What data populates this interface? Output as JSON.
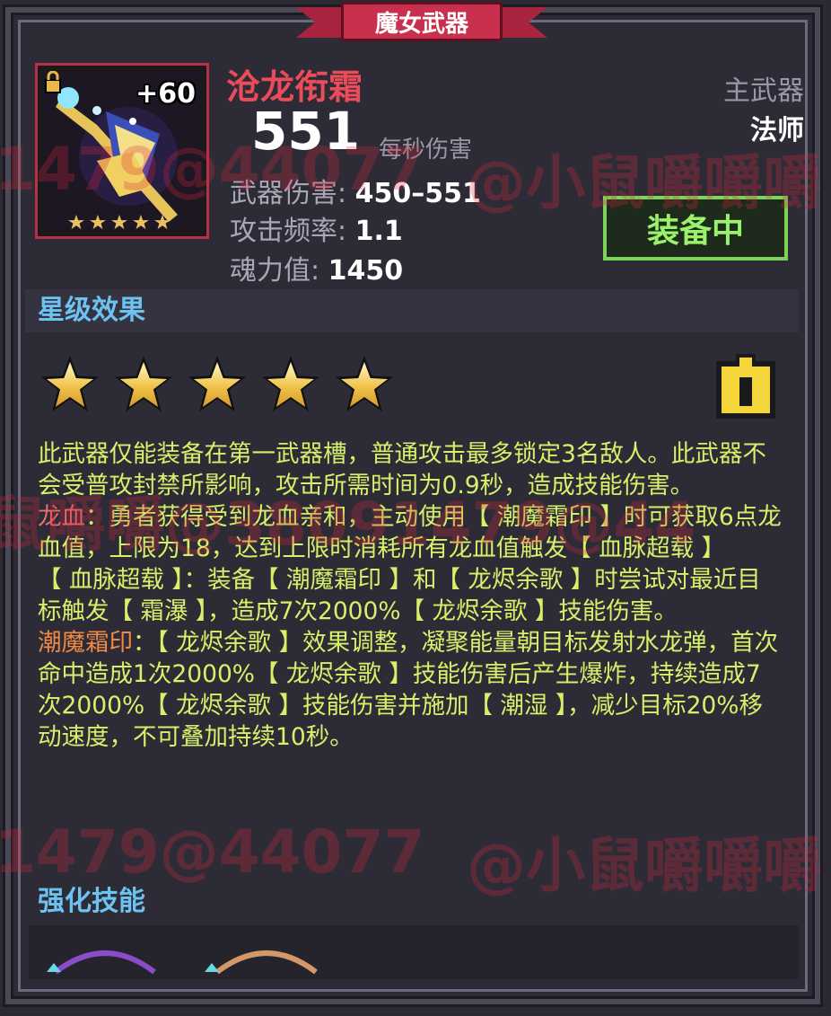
{
  "title": "魔女武器",
  "weapon": {
    "name": "沧龙衔霜",
    "level_badge": "+60",
    "dps": "551",
    "dps_label": "每秒伤害",
    "slot": "主武器",
    "class": "法师",
    "equip_button": "装备中",
    "star_count": 5,
    "stats": [
      {
        "label": "武器伤害: ",
        "value": "450–551"
      },
      {
        "label": "攻击频率: ",
        "value": "1.1"
      },
      {
        "label": "魂力值: ",
        "value": "1450"
      }
    ]
  },
  "sections": {
    "star_effects": "星级效果",
    "enhance_skills": "强化技能"
  },
  "description": {
    "p1": "此武器仅能装备在第一武器槽，普通攻击最多锁定3名敌人。此武器不会受普攻封禁所影响，攻击所需时间为0.9秒，造成技能伤害。",
    "p2_key": "龙血",
    "p2": "：勇者获得受到龙血亲和，主动使用【 潮魔霜印 】时可获取6点龙血值，上限为18，达到上限时消耗所有龙血值触发【 血脉超载 】",
    "p3": "【 血脉超载 】：装备【 潮魔霜印 】和【 龙烬余歌 】时尝试对最近目标触发【 霜瀑 】，造成7次2000%【 龙烬余歌 】技能伤害。",
    "p4_key": "潮魔霜印",
    "p4": "：【 龙烬余歌 】效果调整，凝聚能量朝目标发射水龙弹，首次命中造成1次2000%【 龙烬余歌 】技能伤害后产生爆炸，持续造成7次2000%【 龙烬余歌 】技能伤害并施加【 潮湿 】，减少目标20%移动速度，不可叠加持续10秒。"
  },
  "watermarks": {
    "w1": "1479@44077",
    "w2": "@小鼠嚼嚼嚼",
    "w3": "鼠嚼嚼@38091479@44",
    "w4": "1479@44077",
    "w5": "@小鼠嚼嚼嚼"
  },
  "icons": [
    "lock-icon",
    "info-icon",
    "star-icon",
    "weapon-staff-icon"
  ],
  "colors": {
    "name": "#ec4b5a",
    "equip_green": "#7ed35b",
    "section_blue": "#6cc2f0",
    "desc_green": "#d7f06a",
    "keyword_red": "#ec6e6e",
    "keyword_orange": "#f08a45"
  }
}
